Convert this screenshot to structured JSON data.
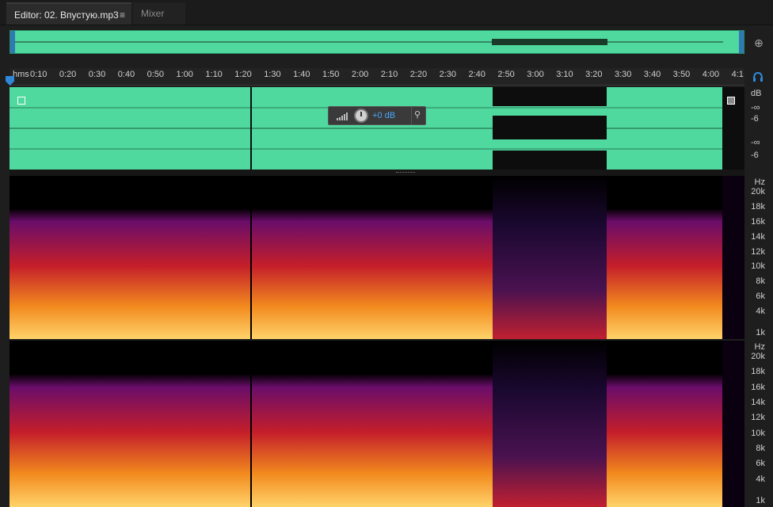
{
  "tabs": {
    "editor_label": "Editor: 02. Впустую.mp3",
    "mixer_label": "Mixer"
  },
  "timeline": {
    "format": "hms",
    "ticks": [
      "0:10",
      "0:20",
      "0:30",
      "0:40",
      "0:50",
      "1:00",
      "1:10",
      "1:20",
      "1:30",
      "1:40",
      "1:50",
      "2:00",
      "2:10",
      "2:20",
      "2:30",
      "2:40",
      "2:50",
      "3:00",
      "3:10",
      "3:20",
      "3:30",
      "3:40",
      "3:50",
      "4:00",
      "4:1"
    ]
  },
  "hud": {
    "value": "+0 dB"
  },
  "db_scale": {
    "ch1": [
      "dB",
      "-∞",
      "-6"
    ],
    "ch2": [
      "-∞",
      "-6"
    ]
  },
  "hz_scale": {
    "labels": [
      "Hz",
      "20k",
      "18k",
      "16k",
      "14k",
      "12k",
      "10k",
      "8k",
      "6k",
      "4k",
      "1k"
    ]
  },
  "colors": {
    "waveform_bg": "#4fd99e",
    "accent": "#2f88d8"
  },
  "icons": {
    "menu": "≡",
    "zoom": "⊕",
    "headphones": "headphones-icon",
    "pin": "pin-icon"
  }
}
